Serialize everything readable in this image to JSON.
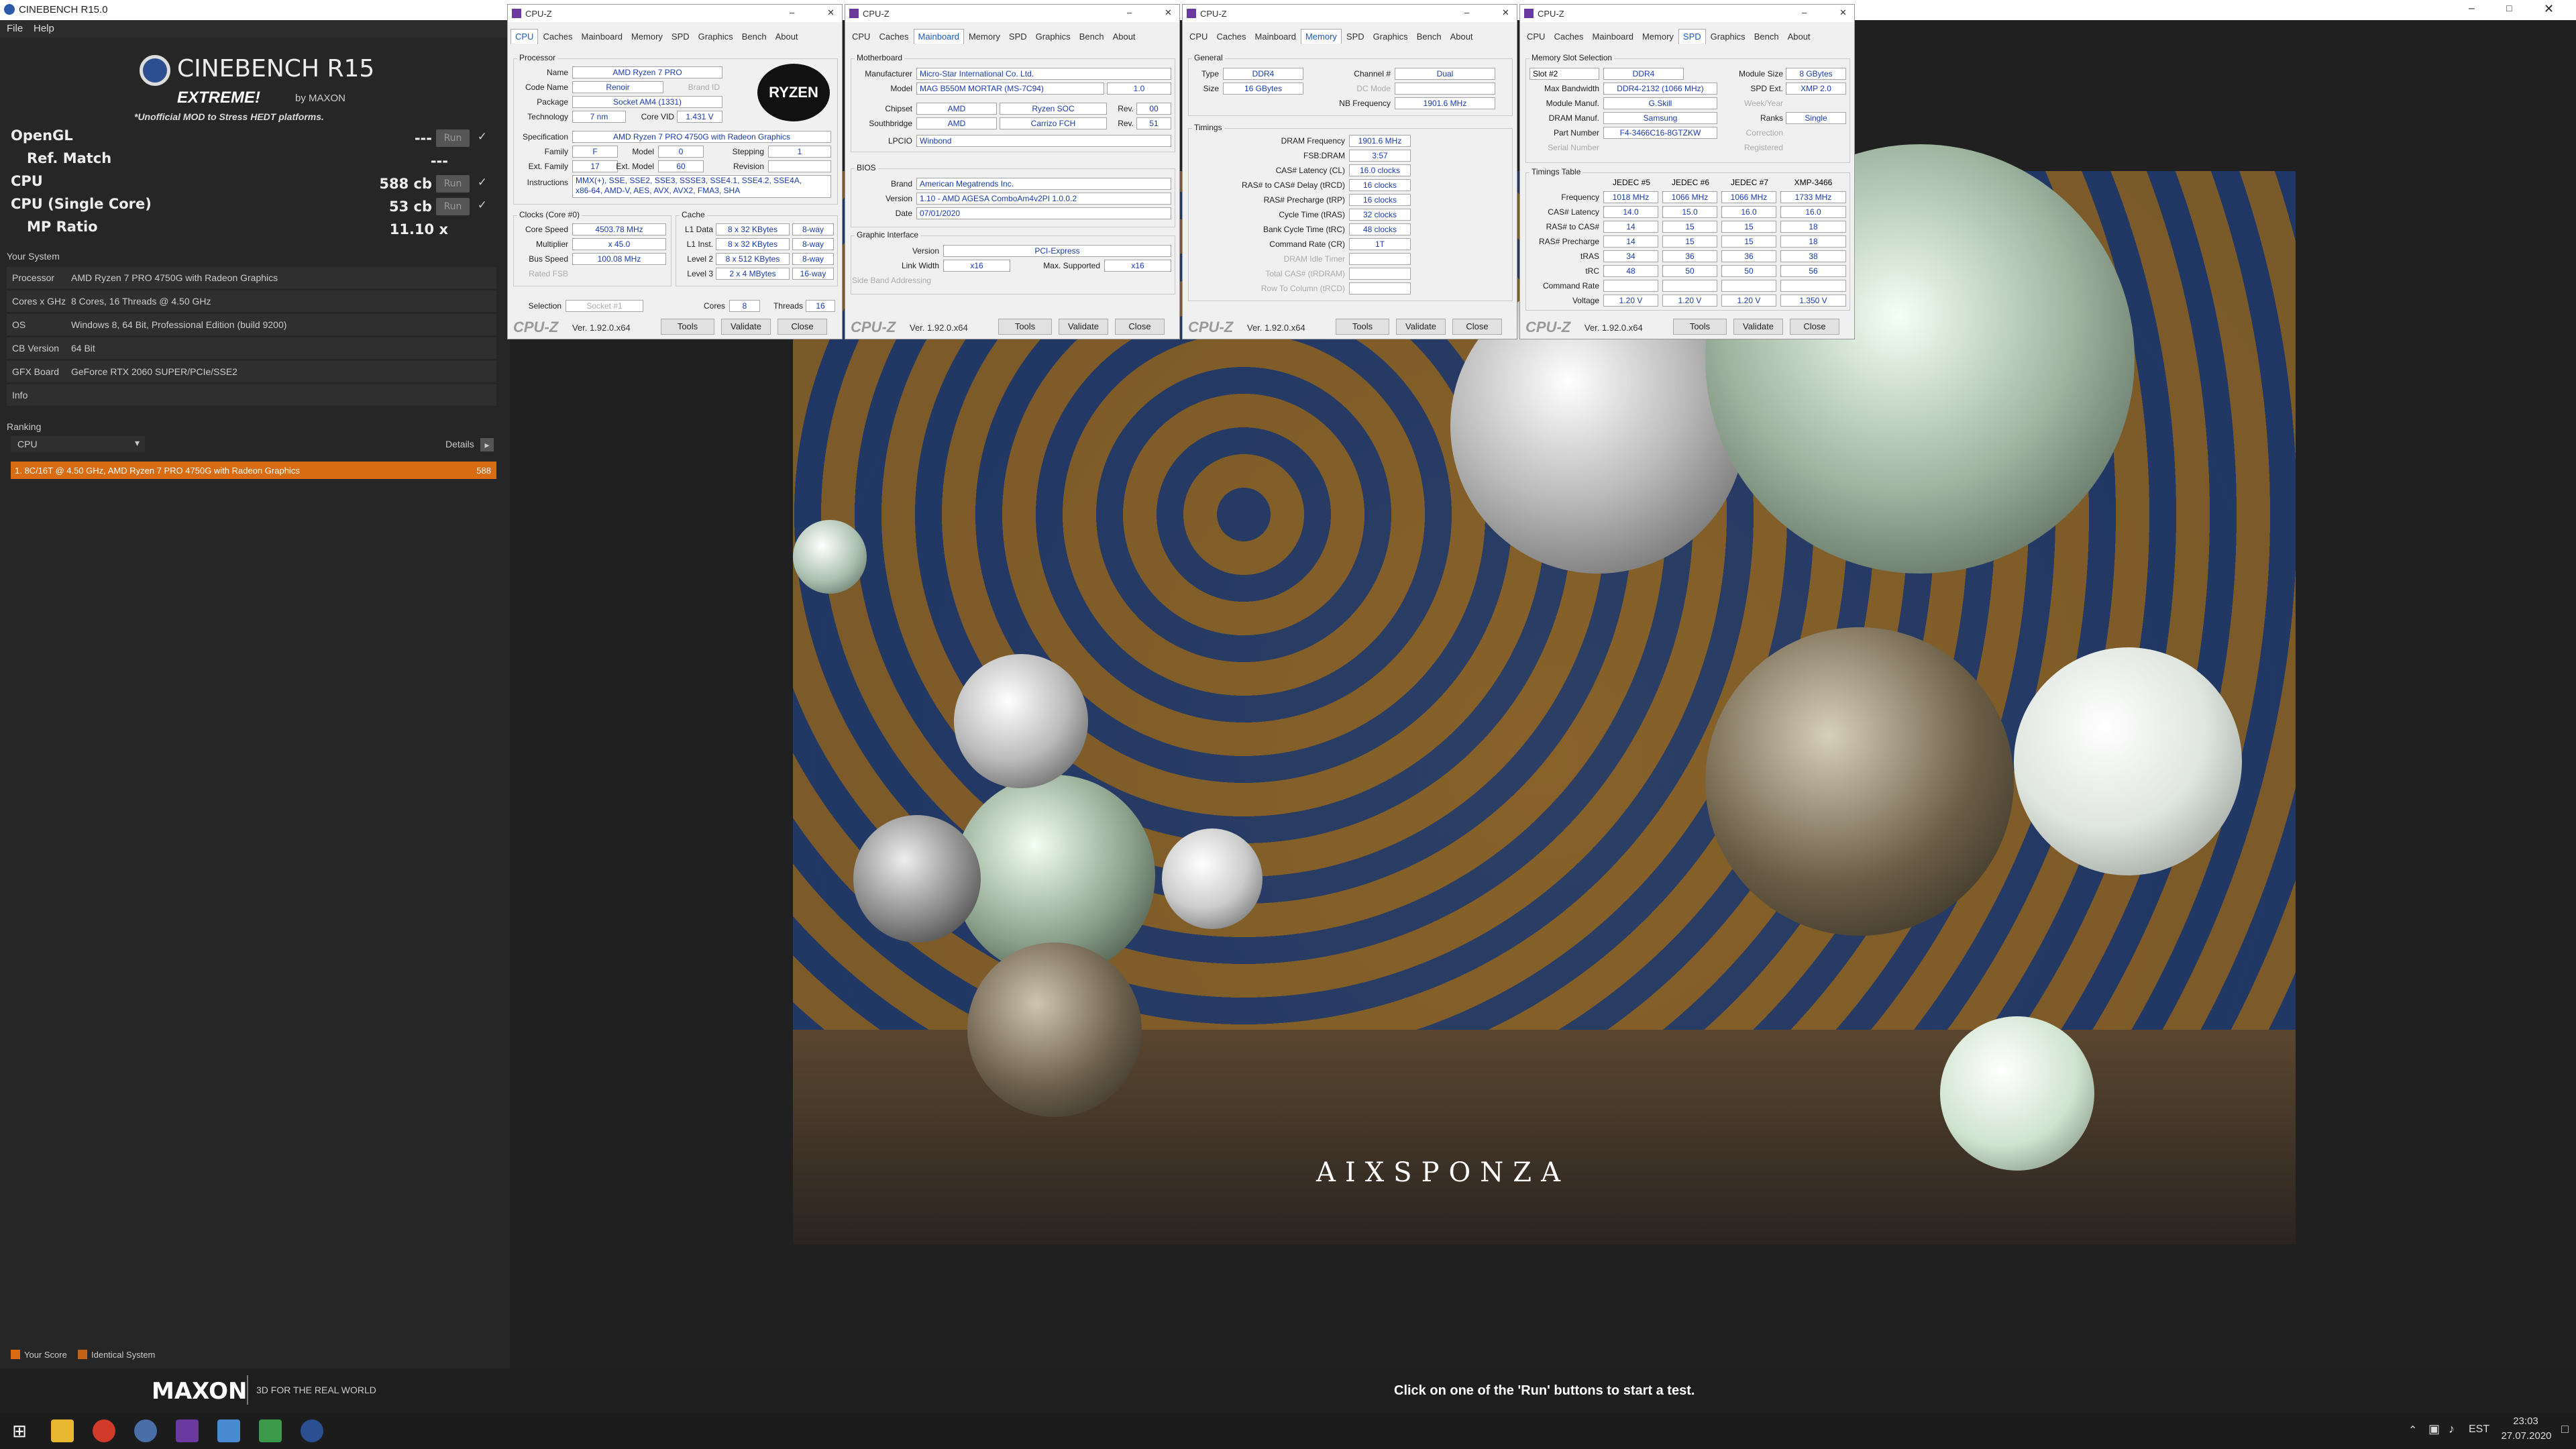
{
  "app": {
    "title": "CINEBENCH R15.0",
    "menu": [
      "File",
      "Help"
    ],
    "logo_title": "CINEBENCH R15",
    "logo_by": "by MAXON",
    "logo_sub": "EXTREME!",
    "logo_tag": "*Unofficial MOD to Stress HEDT platforms."
  },
  "bench": {
    "opengl": {
      "label": "OpenGL",
      "value": "---",
      "run": "Run"
    },
    "refmatch": {
      "label": "Ref. Match",
      "value": "---"
    },
    "cpu": {
      "label": "CPU",
      "value": "588 cb",
      "run": "Run"
    },
    "cpusingle": {
      "label": "CPU (Single Core)",
      "value": "53 cb",
      "run": "Run"
    },
    "mpratio": {
      "label": "MP Ratio",
      "value": "11.10 x"
    }
  },
  "system": {
    "heading": "Your System",
    "rows": [
      {
        "k": "Processor",
        "v": "AMD Ryzen 7 PRO 4750G with Radeon Graphics"
      },
      {
        "k": "Cores x GHz",
        "v": "8 Cores, 16 Threads @ 4.50 GHz"
      },
      {
        "k": "OS",
        "v": "Windows 8, 64 Bit, Professional Edition (build 9200)"
      },
      {
        "k": "CB Version",
        "v": "64 Bit"
      },
      {
        "k": "GFX Board",
        "v": "GeForce RTX 2060 SUPER/PCIe/SSE2"
      },
      {
        "k": "Info",
        "v": ""
      }
    ]
  },
  "ranking": {
    "heading": "Ranking",
    "select": "CPU",
    "details": "Details",
    "entry": "1. 8C/16T @ 4.50 GHz, AMD Ryzen 7 PRO 4750G with Radeon Graphics",
    "entry_score": "588",
    "legend_your": "Your Score",
    "legend_ident": "Identical System"
  },
  "footer": {
    "brand": "MAXON",
    "tag": "3D FOR THE REAL WORLD",
    "hint": "Click on one of the 'Run' buttons to start a test.",
    "watermark": "AIXSPONZA"
  },
  "colors": {
    "accent": "#d96b12",
    "bg": "#262626",
    "cpuz_value": "#1a3bb0"
  },
  "cpuz_common": {
    "title": "CPU-Z",
    "tabs": [
      "CPU",
      "Caches",
      "Mainboard",
      "Memory",
      "SPD",
      "Graphics",
      "Bench",
      "About"
    ],
    "version": "Ver. 1.92.0.x64",
    "tools": "Tools",
    "validate": "Validate",
    "close": "Close",
    "logo": "CPU-Z"
  },
  "cpuz1": {
    "processor": "Processor",
    "name_l": "Name",
    "name": "AMD Ryzen 7 PRO",
    "codename_l": "Code Name",
    "codename": "Renoir",
    "brandid": "Brand ID",
    "package_l": "Package",
    "package": "Socket AM4 (1331)",
    "tech_l": "Technology",
    "tech": "7 nm",
    "vid_l": "Core VID",
    "vid": "1.431 V",
    "spec_l": "Specification",
    "spec": "AMD Ryzen 7 PRO 4750G with Radeon Graphics",
    "family_l": "Family",
    "family": "F",
    "model_l": "Model",
    "model": "0",
    "stepping_l": "Stepping",
    "stepping": "1",
    "extfam_l": "Ext. Family",
    "extfam": "17",
    "extmodel_l": "Ext. Model",
    "extmodel": "60",
    "revision_l": "Revision",
    "revision": "",
    "instr_l": "Instructions",
    "instr1": "MMX(+), SSE, SSE2, SSE3, SSSE3, SSE4.1, SSE4.2, SSE4A,",
    "instr2": "x86-64, AMD-V, AES, AVX, AVX2, FMA3, SHA",
    "clocks": "Clocks (Core #0)",
    "cache": "Cache",
    "speed_l": "Core Speed",
    "speed": "4503.78 MHz",
    "mult_l": "Multiplier",
    "mult": "x 45.0",
    "bus_l": "Bus Speed",
    "bus": "100.08 MHz",
    "fsb_l": "Rated FSB",
    "l1d_l": "L1 Data",
    "l1d": "8 x 32 KBytes",
    "l1d_w": "8-way",
    "l1i_l": "L1 Inst.",
    "l1i": "8 x 32 KBytes",
    "l1i_w": "8-way",
    "l2_l": "Level 2",
    "l2": "8 x 512 KBytes",
    "l2_w": "8-way",
    "l3_l": "Level 3",
    "l3": "2 x 4 MBytes",
    "l3_w": "16-way",
    "sel_l": "Selection",
    "sel": "Socket #1",
    "cores_l": "Cores",
    "cores": "8",
    "threads_l": "Threads",
    "threads": "16",
    "badge": "RYZEN"
  },
  "cpuz2": {
    "mb": "Motherboard",
    "man_l": "Manufacturer",
    "man": "Micro-Star International Co. Ltd.",
    "model_l": "Model",
    "model": "MAG B550M MORTAR (MS-7C94)",
    "model_rev": "1.0",
    "chip_l": "Chipset",
    "chip": "AMD",
    "chip2": "Ryzen SOC",
    "rev_l": "Rev.",
    "chip_rev": "00",
    "sb_l": "Southbridge",
    "sb": "AMD",
    "sb2": "Carrizo FCH",
    "sb_rev": "51",
    "lpcio_l": "LPCIO",
    "lpcio": "Winbond",
    "bios": "BIOS",
    "brand_l": "Brand",
    "brand": "American Megatrends Inc.",
    "ver_l": "Version",
    "ver": "1.10 - AMD AGESA ComboAm4v2PI 1.0.0.2",
    "date_l": "Date",
    "date": "07/01/2020",
    "gi": "Graphic Interface",
    "gver_l": "Version",
    "gver": "PCI-Express",
    "lw_l": "Link Width",
    "lw": "x16",
    "ms_l": "Max. Supported",
    "ms": "x16",
    "sba_l": "Side Band Addressing"
  },
  "cpuz3": {
    "gen": "General",
    "type_l": "Type",
    "type": "DDR4",
    "chan_l": "Channel #",
    "chan": "Dual",
    "size_l": "Size",
    "size": "16 GBytes",
    "dc_l": "DC Mode",
    "nb_l": "NB Frequency",
    "nb": "1901.6 MHz",
    "timings": "Timings",
    "dram_l": "DRAM Frequency",
    "dram": "1901.6 MHz",
    "fsbd_l": "FSB:DRAM",
    "fsbd": "3:57",
    "cl_l": "CAS# Latency (CL)",
    "cl": "16.0 clocks",
    "trcd_l": "RAS# to CAS# Delay (tRCD)",
    "trcd": "16 clocks",
    "trp_l": "RAS# Precharge (tRP)",
    "trp": "16 clocks",
    "tras_l": "Cycle Time (tRAS)",
    "tras": "32 clocks",
    "trc_l": "Bank Cycle Time (tRC)",
    "trc": "48 clocks",
    "cr_l": "Command Rate (CR)",
    "cr": "1T",
    "idle_l": "DRAM Idle Timer",
    "tcas_l": "Total CAS# (tRDRAM)",
    "rtc_l": "Row To Column (tRCD)"
  },
  "cpuz4": {
    "mss": "Memory Slot Selection",
    "slot": "Slot #2",
    "stype": "DDR4",
    "msize_l": "Module Size",
    "msize": "8 GBytes",
    "bw_l": "Max Bandwidth",
    "bw": "DDR4-2132 (1066 MHz)",
    "spdext_l": "SPD Ext.",
    "spdext": "XMP 2.0",
    "mm_l": "Module Manuf.",
    "mm": "G.Skill",
    "wy_l": "Week/Year",
    "dm_l": "DRAM Manuf.",
    "dm": "Samsung",
    "ranks_l": "Ranks",
    "ranks": "Single",
    "pn_l": "Part Number",
    "pn": "F4-3466C16-8GTZKW",
    "corr_l": "Correction",
    "sn_l": "Serial Number",
    "reg_l": "Registered",
    "tt": "Timings Table",
    "cols": [
      "JEDEC #5",
      "JEDEC #6",
      "JEDEC #7",
      "XMP-3466"
    ],
    "rows": [
      {
        "l": "Frequency",
        "v": [
          "1018 MHz",
          "1066 MHz",
          "1066 MHz",
          "1733 MHz"
        ]
      },
      {
        "l": "CAS# Latency",
        "v": [
          "14.0",
          "15.0",
          "16.0",
          "16.0"
        ]
      },
      {
        "l": "RAS# to CAS#",
        "v": [
          "14",
          "15",
          "15",
          "18"
        ]
      },
      {
        "l": "RAS# Precharge",
        "v": [
          "14",
          "15",
          "15",
          "18"
        ]
      },
      {
        "l": "tRAS",
        "v": [
          "34",
          "36",
          "36",
          "38"
        ]
      },
      {
        "l": "tRC",
        "v": [
          "48",
          "50",
          "50",
          "56"
        ]
      },
      {
        "l": "Command Rate",
        "v": [
          "",
          "",
          "",
          ""
        ]
      },
      {
        "l": "Voltage",
        "v": [
          "1.20 V",
          "1.20 V",
          "1.20 V",
          "1.350 V"
        ]
      }
    ]
  },
  "tray": {
    "lang": "EST",
    "time": "23:03",
    "date": "27.07.2020"
  }
}
